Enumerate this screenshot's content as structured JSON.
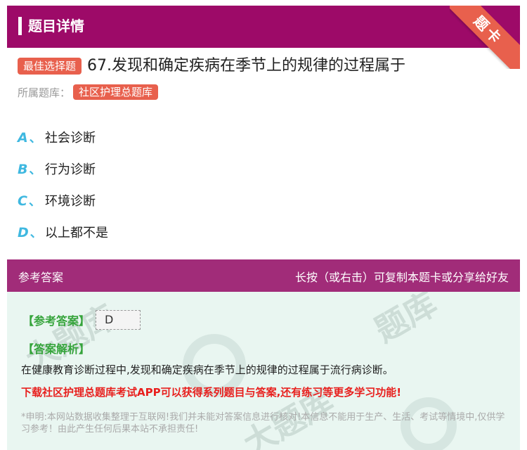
{
  "header": {
    "title": "题目详情",
    "ribbon": "题卡"
  },
  "question": {
    "type_badge": "最佳选择题",
    "text": "67.发现和确定疾病在季节上的规律的过程属于",
    "bank_label": "所属题库：",
    "bank_name": "社区护理总题库"
  },
  "options": [
    {
      "letter": "A",
      "sep": "、",
      "text": "社会诊断"
    },
    {
      "letter": "B",
      "sep": "、",
      "text": "行为诊断"
    },
    {
      "letter": "C",
      "sep": "、",
      "text": "环境诊断"
    },
    {
      "letter": "D",
      "sep": "、",
      "text": "以上都不是"
    }
  ],
  "answer": {
    "section_title": "参考答案",
    "share_hint": "长按（或右击）可复制本题卡或分享给好友",
    "ref_label": "【参考答案】",
    "ref_value": "D",
    "analysis_label": "【答案解析】",
    "analysis_text": "在健康教育诊断过程中,发现和确定疾病在季节上的规律的过程属于流行病诊断。",
    "promo": "下载社区护理总题库考试APP可以获得系列题目与答案,还有练习等更多学习功能!",
    "disclaimer": "*申明:本网站数据收集整理于互联网!我们并未能对答案信息进行核对!本信息不能用于生产、生活、考试等情境中,仅供学习参考！由此产生任何后果本站不承担责任!"
  },
  "colors": {
    "header": "#9d0a68",
    "accent": "#e8604d",
    "option_letter": "#3fb8e0",
    "answer_bg": "#e9f6f1",
    "green": "#36a43c",
    "promo": "#e8201e"
  }
}
